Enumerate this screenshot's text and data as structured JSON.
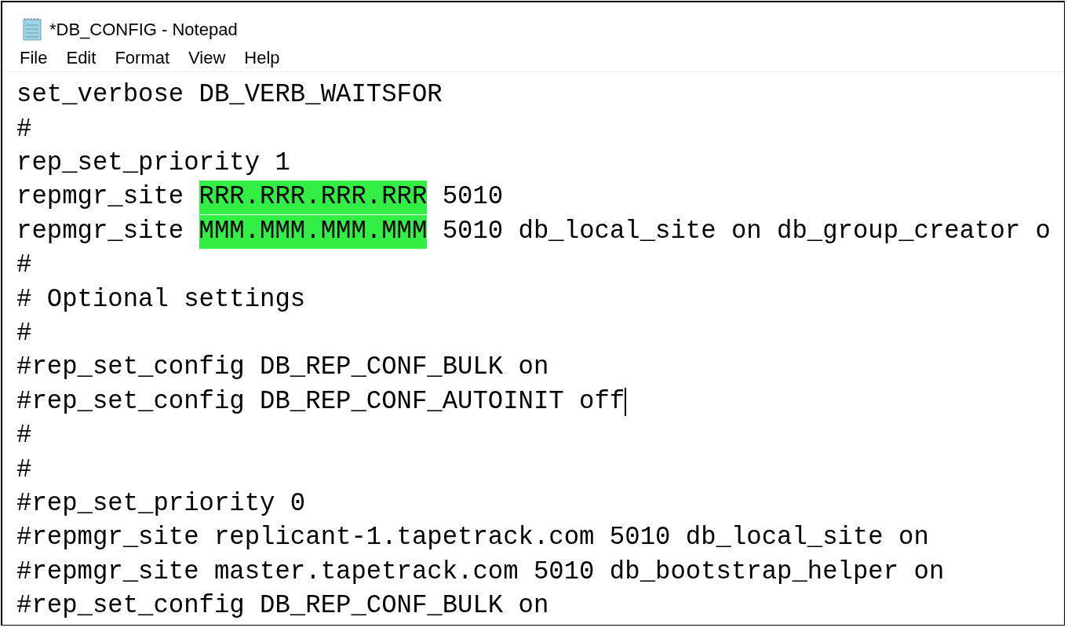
{
  "window": {
    "title": "*DB_CONFIG - Notepad"
  },
  "menu": [
    "File",
    "Edit",
    "Format",
    "View",
    "Help"
  ],
  "lines": [
    {
      "cursor": false,
      "segments": [
        {
          "text": "set_verbose DB_VERB_WAITSFOR",
          "highlighted": false
        }
      ]
    },
    {
      "cursor": false,
      "segments": [
        {
          "text": "#",
          "highlighted": false
        }
      ]
    },
    {
      "cursor": false,
      "segments": [
        {
          "text": "rep_set_priority 1",
          "highlighted": false
        }
      ]
    },
    {
      "cursor": false,
      "segments": [
        {
          "text": "repmgr_site ",
          "highlighted": false
        },
        {
          "text": "RRR.RRR.RRR.RRR",
          "highlighted": true
        },
        {
          "text": " 5010",
          "highlighted": false
        }
      ]
    },
    {
      "cursor": false,
      "segments": [
        {
          "text": "repmgr_site ",
          "highlighted": false
        },
        {
          "text": "MMM.MMM.MMM.MMM",
          "highlighted": true
        },
        {
          "text": " 5010 db_local_site on db_group_creator o",
          "highlighted": false
        }
      ]
    },
    {
      "cursor": false,
      "segments": [
        {
          "text": "#",
          "highlighted": false
        }
      ]
    },
    {
      "cursor": false,
      "segments": [
        {
          "text": "# Optional settings",
          "highlighted": false
        }
      ]
    },
    {
      "cursor": false,
      "segments": [
        {
          "text": "#",
          "highlighted": false
        }
      ]
    },
    {
      "cursor": false,
      "segments": [
        {
          "text": "#rep_set_config DB_REP_CONF_BULK on",
          "highlighted": false
        }
      ]
    },
    {
      "cursor": true,
      "segments": [
        {
          "text": "#rep_set_config DB_REP_CONF_AUTOINIT off",
          "highlighted": false
        }
      ]
    },
    {
      "cursor": false,
      "segments": [
        {
          "text": "#",
          "highlighted": false
        }
      ]
    },
    {
      "cursor": false,
      "segments": [
        {
          "text": "#",
          "highlighted": false
        }
      ]
    },
    {
      "cursor": false,
      "segments": [
        {
          "text": "#rep_set_priority 0",
          "highlighted": false
        }
      ]
    },
    {
      "cursor": false,
      "segments": [
        {
          "text": "#repmgr_site replicant-1.tapetrack.com 5010 db_local_site on",
          "highlighted": false
        }
      ]
    },
    {
      "cursor": false,
      "segments": [
        {
          "text": "#repmgr_site master.tapetrack.com 5010 db_bootstrap_helper on",
          "highlighted": false
        }
      ]
    },
    {
      "cursor": false,
      "segments": [
        {
          "text": "#rep_set_config DB_REP_CONF_BULK on",
          "highlighted": false
        }
      ]
    }
  ]
}
